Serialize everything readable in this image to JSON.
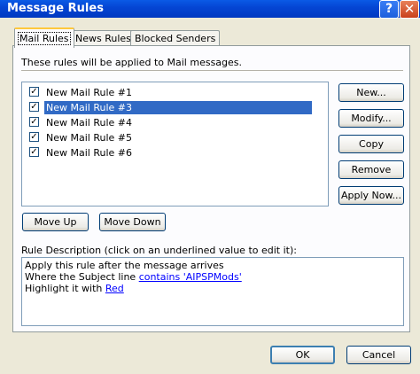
{
  "window": {
    "title": "Message Rules",
    "help_label": "?",
    "close_label": "✕"
  },
  "tabs": [
    {
      "label": "Mail Rules",
      "active": true
    },
    {
      "label": "News Rules",
      "active": false
    },
    {
      "label": "Blocked Senders",
      "active": false
    }
  ],
  "caption": "These rules will be applied to Mail messages.",
  "rules": [
    {
      "label": "New Mail Rule #1",
      "checked": true,
      "selected": false
    },
    {
      "label": "New Mail Rule #3",
      "checked": true,
      "selected": true
    },
    {
      "label": "New Mail Rule #4",
      "checked": true,
      "selected": false
    },
    {
      "label": "New Mail Rule #5",
      "checked": true,
      "selected": false
    },
    {
      "label": "New Mail Rule #6",
      "checked": true,
      "selected": false
    }
  ],
  "side_buttons": {
    "new": "New...",
    "modify": "Modify...",
    "copy": "Copy",
    "remove": "Remove",
    "apply_now": "Apply Now..."
  },
  "move_up": "Move Up",
  "move_down": "Move Down",
  "description": {
    "label": "Rule Description (click on an underlined value to edit it):",
    "line1": "Apply this rule after the message arrives",
    "line2_prefix": "Where the Subject line ",
    "line2_link": "contains 'AIPSPMods'",
    "line3_prefix": "Highlight it with ",
    "line3_link": "Red"
  },
  "footer": {
    "ok": "OK",
    "cancel": "Cancel"
  },
  "colors": {
    "title_bar": "#0546d4",
    "selection": "#316ac5",
    "dialog_bg": "#ece9d8",
    "tab_highlight": "#ffc83c"
  }
}
